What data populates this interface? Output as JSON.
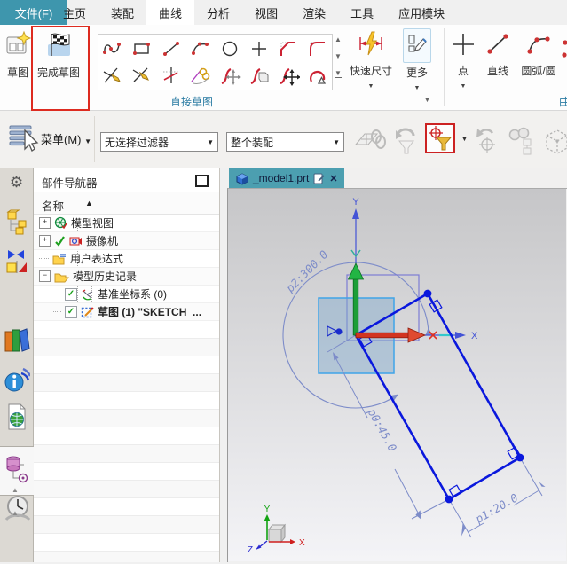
{
  "ui": {
    "close": "✕",
    "up": "▲",
    "down": "▼",
    "dropdown": "▼",
    "check": "✓",
    "gear": "⚙",
    "sort_asc": "▲"
  },
  "menu_tabs": {
    "file": "文件(F)",
    "items": [
      "主页",
      "装配",
      "曲线",
      "分析",
      "视图",
      "渲染",
      "工具",
      "应用模块"
    ],
    "active": "曲线"
  },
  "ribbon": {
    "sketch_label": "草图",
    "finish_sketch_label": "完成草图",
    "quick_dim_label": "快速尺寸",
    "more_label": "更多",
    "point_label": "点",
    "line_label": "直线",
    "arc_circle_label": "圆弧/圆",
    "group_direct_sketch": "直接草图",
    "group_curve_clipped": "曲"
  },
  "toolbar": {
    "menu_label": "菜单(M)",
    "selection_filter": "无选择过滤器",
    "selection_scope": "整个装配"
  },
  "navigator": {
    "title": "部件导航器",
    "name_column": "名称",
    "rows": [
      {
        "label": "模型视图",
        "expander": "+"
      },
      {
        "label": "摄像机",
        "expander": "+"
      },
      {
        "label": "用户表达式",
        "expander": ""
      },
      {
        "label": "模型历史记录",
        "expander": "−"
      },
      {
        "label": "基准坐标系 (0)",
        "expander": "",
        "checked": true
      },
      {
        "label": "草图 (1) \"SKETCH_...",
        "expander": "",
        "checked": true,
        "selected": true
      }
    ]
  },
  "viewport": {
    "tab_title": "_model1.prt",
    "dimensions": {
      "p0": "p0:45.0",
      "p1": "p1:20.0",
      "p2": "p2:300.0"
    },
    "axes": {
      "x": "X",
      "y": "Y"
    },
    "triad": {
      "x": "X",
      "y": "Y",
      "z": "Z"
    }
  },
  "colors": {
    "accent_teal": "#3e96ad",
    "annotation_red": "#dd2b20",
    "sketch_blue": "#0a18dd",
    "dimension_blue": "#7d8cc9"
  }
}
